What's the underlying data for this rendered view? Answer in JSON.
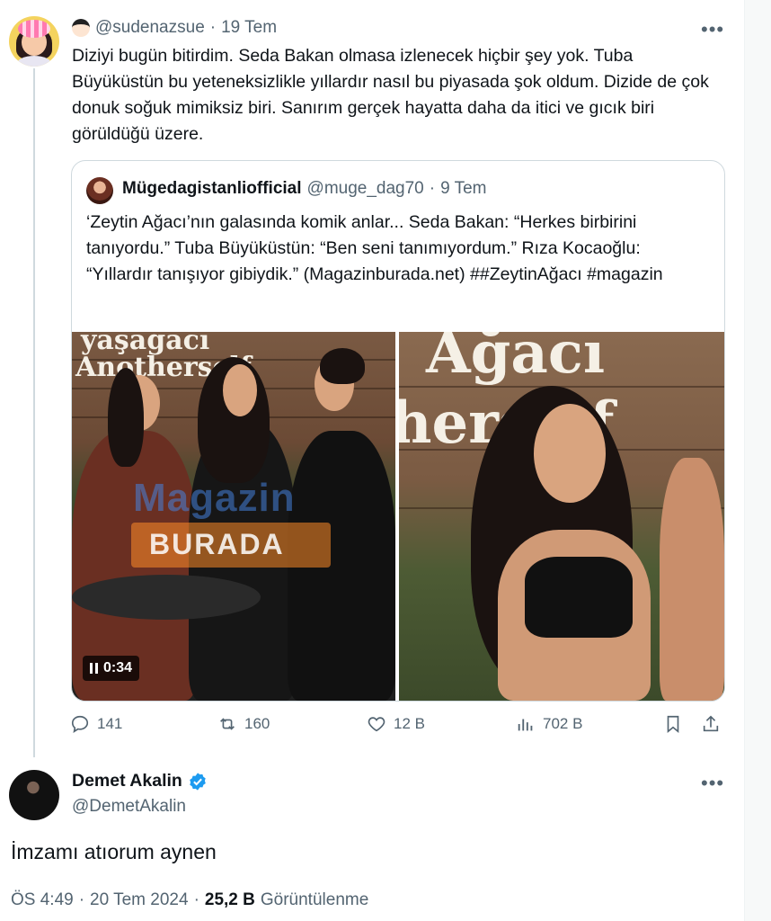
{
  "original_tweet": {
    "handle": "@sudenazsue",
    "separator": "·",
    "date": "19 Tem",
    "text": "Diziyi bugün bitirdim. Seda Bakan olmasa izlenecek hiçbir şey yok. Tuba Büyüküstün bu yeteneksizlikle yıllardır nasıl bu piyasada şok oldum. Dizide de çok donuk soğuk mimiksiz biri. Sanırım gerçek hayatta daha da itici ve gıcık biri görüldüğü üzere."
  },
  "quoted_tweet": {
    "name": "Mügedagistanliofficial",
    "handle": "@muge_dag70",
    "separator": "·",
    "date": "9 Tem",
    "text": "‘Zeytin Ağacı’nın galasında komik anlar... Seda Bakan: “Herkes birbirini tanıyordu.” Tuba Büyüküstün: “Ben seni tanımıyordum.” Rıza Kocaoğlu: “Yıllardır tanışıyor gibiydik.” (Magazinburada.net) ##ZeytinAğacı #magazin",
    "video_time": "0:34",
    "watermark_top": "Magazin",
    "watermark_bottom": "BURADA",
    "sign_left_1": "yaşağacı",
    "sign_left_2": "Anotherself",
    "sign_right_1": "Ağacı",
    "sign_right_2": "herself"
  },
  "actions": {
    "replies": "141",
    "retweets": "160",
    "likes": "12 B",
    "views": "702 B"
  },
  "reply_tweet": {
    "name": "Demet Akalin",
    "handle": "@DemetAkalin",
    "text": "İmzamı atıorum aynen",
    "time": "ÖS 4:49",
    "separator": "·",
    "date": "20 Tem 2024",
    "view_count": "25,2 B",
    "view_label": "Görüntülenme"
  },
  "colors": {
    "text": "#0f1419",
    "secondary": "#536471",
    "border": "#cfd9de",
    "verified": "#1d9bf0"
  }
}
